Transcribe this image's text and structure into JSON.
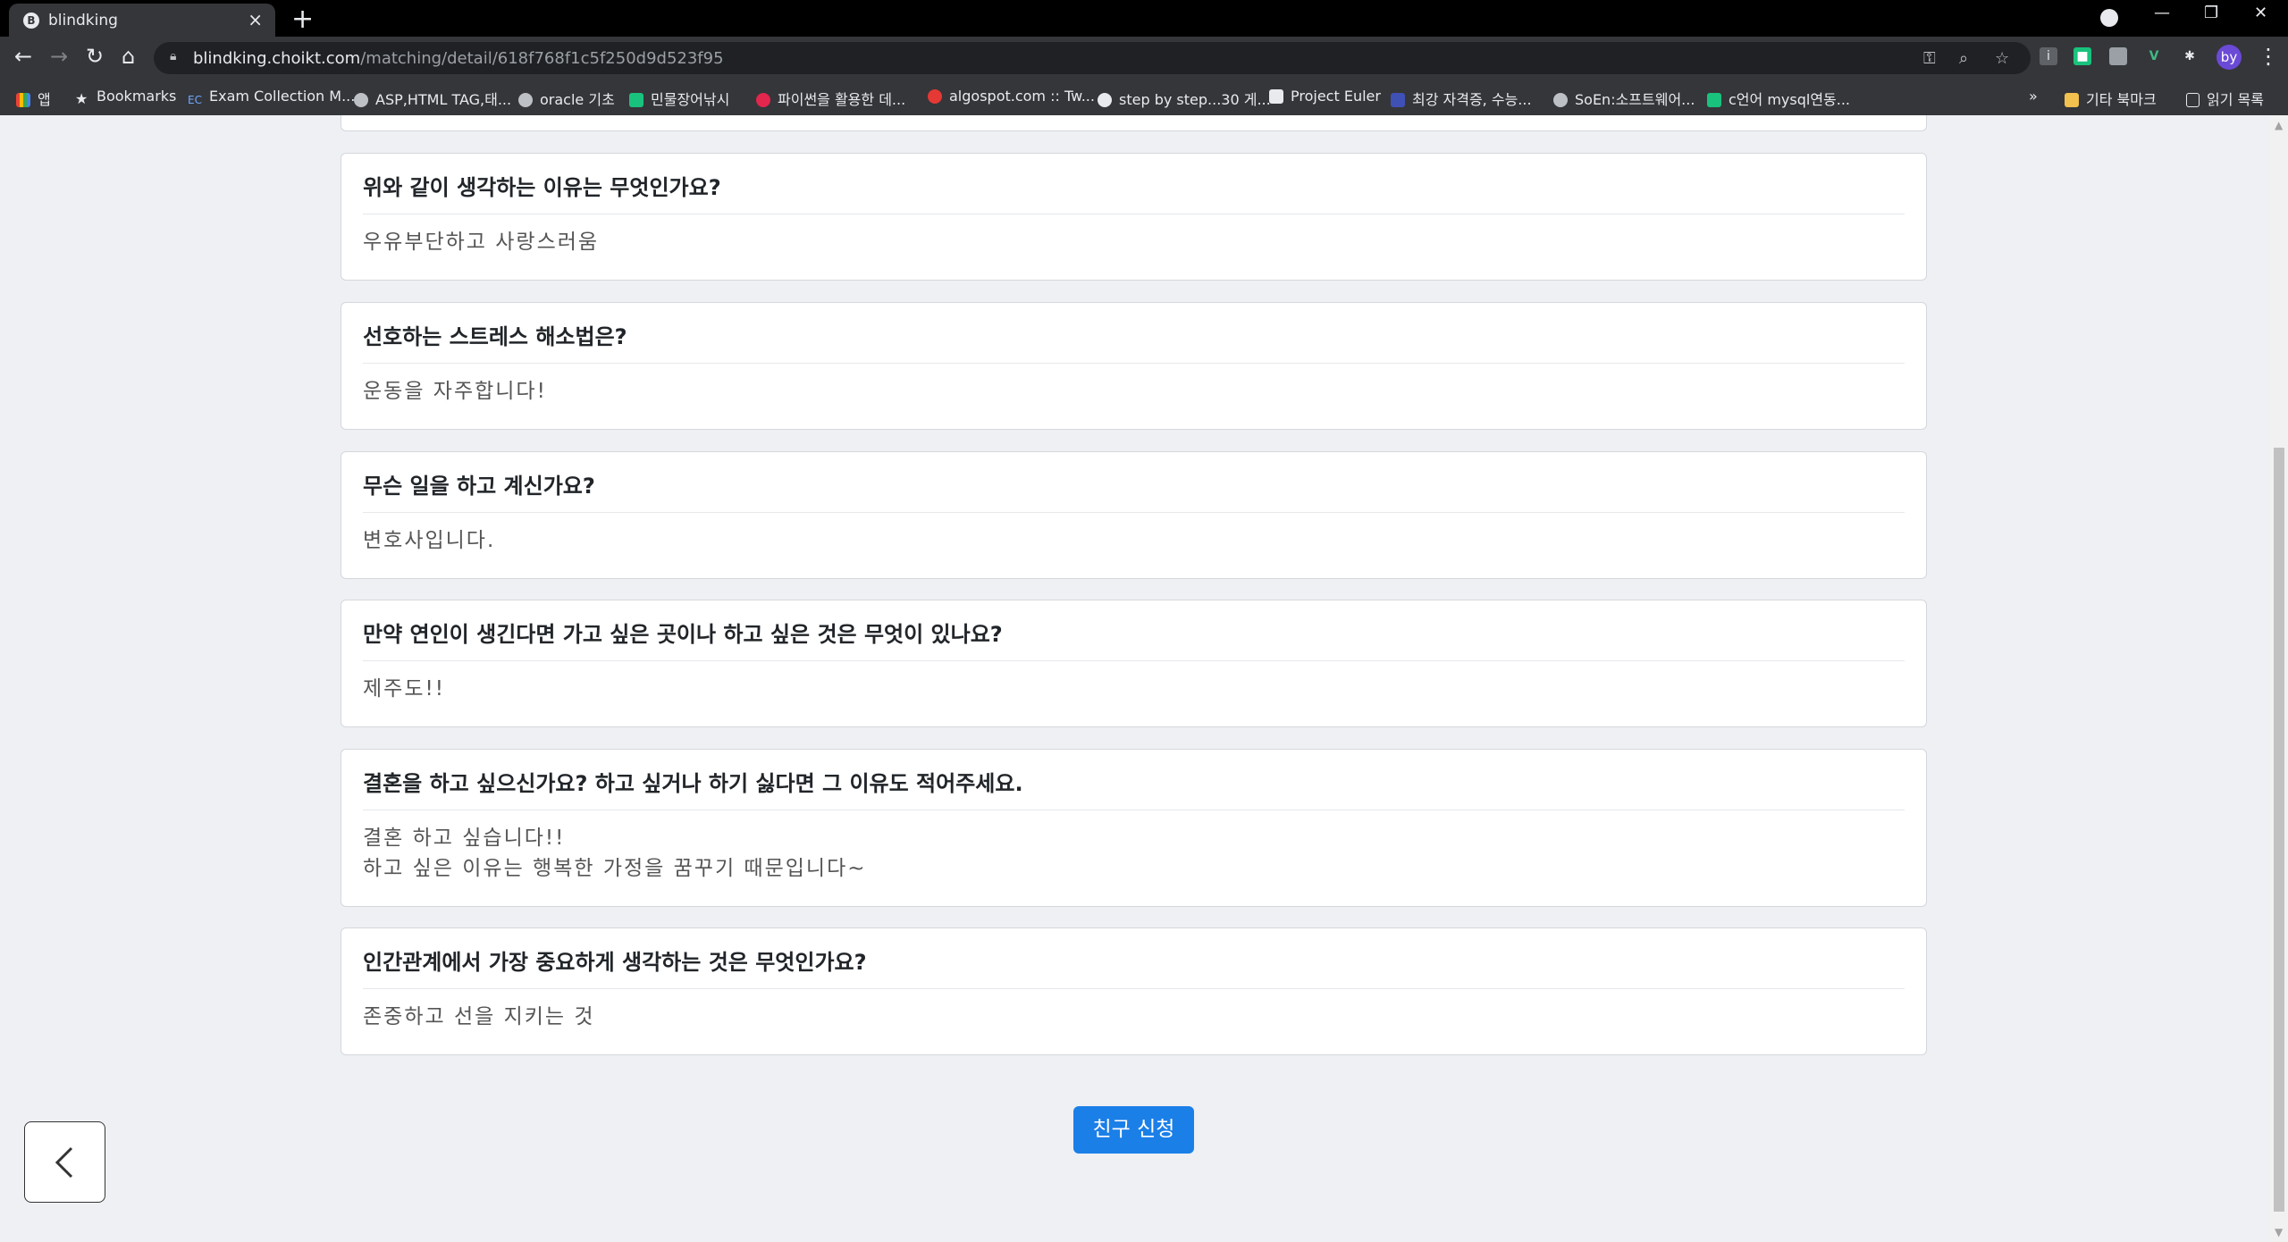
{
  "browser": {
    "tab_title": "blindking",
    "tab_favicon_letter": "B",
    "url_host": "blindking.choikt.com",
    "url_path": "/matching/detail/618f768f1c5f250d9d523f95",
    "avatar_text": "by",
    "bookmarks": [
      {
        "label": "앱",
        "icon": "apps-grid-icon",
        "color": "#e8eaed"
      },
      {
        "label": "Bookmarks",
        "icon": "star-icon",
        "color": "#e8eaed"
      },
      {
        "label": "Exam Collection M...",
        "icon": "ec-icon",
        "color": "#6ea8ff"
      },
      {
        "label": "ASP,HTML TAG,태...",
        "icon": "globe-icon",
        "color": "#bdc1c6"
      },
      {
        "label": "oracle 기초",
        "icon": "globe-icon",
        "color": "#bdc1c6"
      },
      {
        "label": "민물장어낚시",
        "icon": "naver-icon",
        "color": "#19c37d"
      },
      {
        "label": "파이썬을 활용한 데...",
        "icon": "python-icon",
        "color": "#e2264d"
      },
      {
        "label": "algospot.com :: Tw...",
        "icon": "algospot-icon",
        "color": "#e53935"
      },
      {
        "label": "step by step...30 게...",
        "icon": "github-icon",
        "color": "#e8eaed"
      },
      {
        "label": "Project Euler",
        "icon": "euler-icon",
        "color": "#e8eaed"
      },
      {
        "label": "최강 자격증, 수능...",
        "icon": "ebs-icon",
        "color": "#3f51b5"
      },
      {
        "label": "SoEn:소프트웨어...",
        "icon": "globe-icon",
        "color": "#bdc1c6"
      },
      {
        "label": "c언어 mysql연동...",
        "icon": "naver-blog-icon",
        "color": "#19c37d"
      }
    ],
    "bookmarks_more": "»",
    "other_bookmarks": "기타 북마크",
    "reading_list": "읽기 목록"
  },
  "qa": [
    {
      "question": "위와 같이 생각하는 이유는 무엇인가요?",
      "answer": "우유부단하고 사랑스러움"
    },
    {
      "question": "선호하는 스트레스 해소법은?",
      "answer": "운동을 자주합니다!"
    },
    {
      "question": "무슨 일을 하고 계신가요?",
      "answer": "변호사입니다."
    },
    {
      "question": "만약 연인이 생긴다면 가고 싶은 곳이나 하고 싶은 것은 무엇이 있나요?",
      "answer": "제주도!!"
    },
    {
      "question": "결혼을 하고 싶으신가요? 하고 싶거나 하기 싫다면 그 이유도 적어주세요.",
      "answer": "결혼 하고 싶습니다!!\n하고 싶은 이유는 행복한 가정을 꿈꾸기 때문입니다~"
    },
    {
      "question": "인간관계에서 가장 중요하게 생각하는 것은 무엇인가요?",
      "answer": "존중하고 선을 지키는 것"
    }
  ],
  "actions": {
    "friend_request_label": "친구 신청"
  }
}
